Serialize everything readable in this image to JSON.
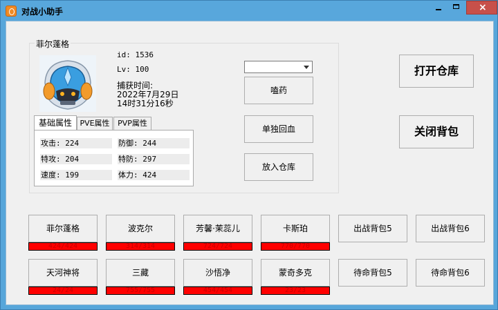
{
  "window": {
    "title": "对战小助手",
    "close_glyph": "×"
  },
  "pet_info": {
    "name": "菲尔蓬格",
    "id_text": "id: 1536",
    "level_text": "Lv: 100",
    "capture_label": "捕获时间:",
    "capture_date": "2022年7月29日",
    "capture_time": "14时31分16秒"
  },
  "tabs": [
    "基础属性",
    "PVE属性",
    "PVP属性"
  ],
  "stats": {
    "attack": "攻击: 224",
    "defense": "防御: 244",
    "sp_attack": "特攻: 204",
    "sp_defense": "特防: 297",
    "speed": "速度: 199",
    "stamina": "体力: 424"
  },
  "item_select": {
    "value": ""
  },
  "actions": {
    "use_item": "嗑药",
    "heal_single": "单独回血",
    "store_warehouse": "放入仓库"
  },
  "right_actions": {
    "open_warehouse": "打开仓库",
    "close_bag": "关闭背包"
  },
  "battle_pets": [
    {
      "name": "菲尔蓬格",
      "hp_text": "424/424",
      "hp_fraction": 1.0
    },
    {
      "name": "波克尔",
      "hp_text": "314/314",
      "hp_fraction": 1.0
    },
    {
      "name": "芳馨·茉蕊儿",
      "hp_text": "724/724",
      "hp_fraction": 1.0
    },
    {
      "name": "卡斯珀",
      "hp_text": "770/770",
      "hp_fraction": 1.0
    }
  ],
  "battle_slots": [
    "出战背包5",
    "出战背包6"
  ],
  "standby_pets": [
    {
      "name": "天河神将",
      "hp_text": "24/24",
      "hp_fraction": 1.0
    },
    {
      "name": "三藏",
      "hp_text": "755/755",
      "hp_fraction": 1.0
    },
    {
      "name": "沙悟净",
      "hp_text": "454/454",
      "hp_fraction": 1.0
    },
    {
      "name": "蒙奇多克",
      "hp_text": "23/23",
      "hp_fraction": 1.0
    }
  ],
  "standby_slots": [
    "待命背包5",
    "待命背包6"
  ],
  "colors": {
    "titlebar": "#58a7dc",
    "close_button": "#c7504a",
    "hp_bar": "#ff0000",
    "hp_text": "#c80000"
  }
}
